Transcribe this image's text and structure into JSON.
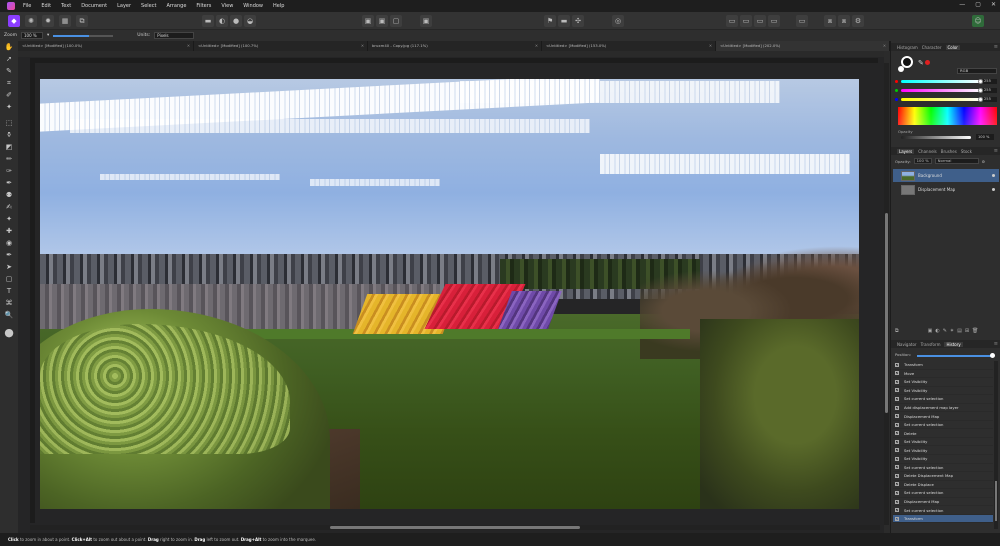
{
  "menu": [
    "File",
    "Edit",
    "Text",
    "Document",
    "Layer",
    "Select",
    "Arrange",
    "Filters",
    "View",
    "Window",
    "Help"
  ],
  "window_controls": [
    "—",
    "▢",
    "✕"
  ],
  "context": {
    "zoom_label": "Zoom",
    "zoom_value": "100 %",
    "units_label": "Units:",
    "units_value": "Pixels"
  },
  "doc_tabs": [
    {
      "label": "<Untitled> [Modified] (100.0%)"
    },
    {
      "label": "<Untitled> [Modified] (100.7%)"
    },
    {
      "label": "bruxm40 - Copy.jpg (117.1%)"
    },
    {
      "label": "<Untitled> [Modified] (153.0%)"
    },
    {
      "label": "<Untitled> [Modified] (202.0%)"
    }
  ],
  "panels": {
    "top_tabs": [
      "Histogram",
      "Character",
      "Color"
    ],
    "color": {
      "model": "RGB",
      "r": "255",
      "g": "255",
      "b": "255",
      "opacity_label": "Opacity",
      "opacity": "100 %"
    },
    "layer_tabs": [
      "Layers",
      "Channels",
      "Brushes",
      "Stock"
    ],
    "layer_opts": {
      "opacity_label": "Opacity:",
      "opacity": "100 %",
      "blend": "Normal"
    },
    "layers": [
      {
        "name": "Background",
        "selected": true
      },
      {
        "name": "Displacement Map",
        "selected": false
      }
    ],
    "bottom_tabs": [
      "Navigator",
      "Transform",
      "History"
    ],
    "history_position_label": "Position:",
    "history": [
      "Transform",
      "Move",
      "Set Visibility",
      "Set Visibility",
      "Set current selection",
      "Add displacement map layer",
      "Displacement Map",
      "Set current selection",
      "Delete",
      "Set Visibility",
      "Set Visibility",
      "Set Visibility",
      "Set current selection",
      "Delete Displacement Map",
      "Delete Displace",
      "Set current selection",
      "Displacement Map",
      "Set current selection",
      "Transform"
    ]
  },
  "status": {
    "s1": "Click",
    "t1": " to zoom in about a point. ",
    "s2": "Click+Alt",
    "t2": " to zoom out about a point. ",
    "s3": "Drag",
    "t3": " right to zoom in. ",
    "s4": "Drag",
    "t4": " left to zoom out. ",
    "s5": "Drag+Alt",
    "t5": " to zoom into the marquee."
  },
  "colors": {
    "accent": "#4a90e2",
    "persona": "#8b3dff",
    "selected_row": "#3f5f8a"
  }
}
